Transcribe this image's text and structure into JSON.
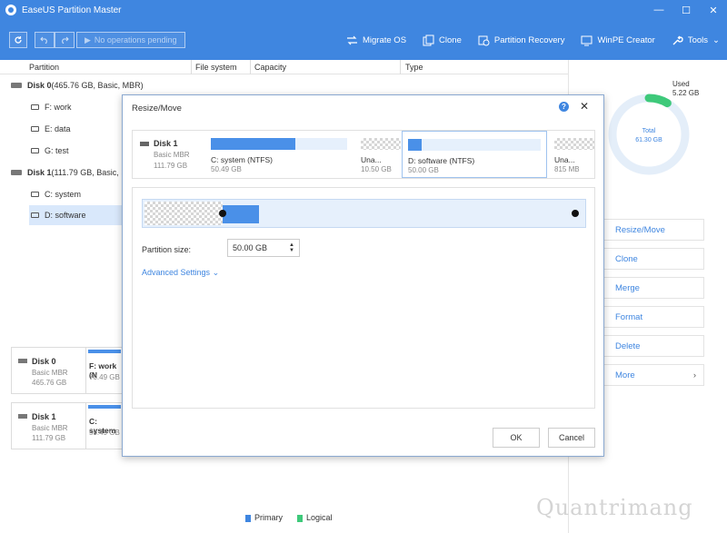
{
  "window": {
    "title": "EaseUS Partition Master"
  },
  "toolbar": {
    "pending": "No operations pending",
    "tools": [
      {
        "label": "Migrate OS",
        "icon": "migrate-icon"
      },
      {
        "label": "Clone",
        "icon": "clone-icon"
      },
      {
        "label": "Partition Recovery",
        "icon": "recovery-icon"
      },
      {
        "label": "WinPE Creator",
        "icon": "winpe-icon"
      },
      {
        "label": "Tools",
        "icon": "wrench-icon"
      }
    ]
  },
  "columns": {
    "partition": "Partition",
    "filesystem": "File system",
    "capacity": "Capacity",
    "type": "Type"
  },
  "tree": [
    {
      "label": "Disk 0",
      "extra": " (465.76 GB, Basic, MBR)",
      "kind": "disk"
    },
    {
      "label": "F: work",
      "kind": "part"
    },
    {
      "label": "E: data",
      "kind": "part"
    },
    {
      "label": "G: test",
      "kind": "part"
    },
    {
      "label": "Disk 1",
      "extra": " (111.79 GB, Basic, MBR)",
      "kind": "disk"
    },
    {
      "label": "C: system",
      "kind": "part"
    },
    {
      "label": "D: software",
      "kind": "part"
    }
  ],
  "disk_cards": [
    {
      "name": "Disk 0",
      "sub": "Basic MBR",
      "size": "465.76 GB",
      "part_name": "F: work (N",
      "part_size": "70.49 GB"
    },
    {
      "name": "Disk 1",
      "sub": "Basic MBR",
      "size": "111.79 GB",
      "part_name": "C: system",
      "part_size": "50.49 GB"
    }
  ],
  "legend": {
    "primary": "Primary",
    "logical": "Logical",
    "primary_color": "#3f86e0",
    "logical_color": "#3ec97a"
  },
  "usage": {
    "used_label": "Used",
    "used_value": "5.22 GB",
    "total_label": "Total",
    "total_value": "61.30 GB",
    "used_fraction": 0.085
  },
  "actions": [
    {
      "label": "Resize/Move"
    },
    {
      "label": "Clone"
    },
    {
      "label": "Merge"
    },
    {
      "label": "Format"
    },
    {
      "label": "Delete"
    },
    {
      "label": "More"
    }
  ],
  "dialog": {
    "title": "Resize/Move",
    "disk": {
      "name": "Disk 1",
      "sub": "Basic MBR",
      "size": "111.79 GB"
    },
    "partitions": [
      {
        "name": "C: system (NTFS)",
        "size": "50.49 GB",
        "used_fraction": 0.62
      },
      {
        "name": "Una...",
        "size": "10.50 GB"
      },
      {
        "name": "D: software (NTFS)",
        "size": "50.00 GB",
        "used_fraction": 0.1
      },
      {
        "name": "Una...",
        "size": "815 MB"
      }
    ],
    "partition_size_label": "Partition size:",
    "partition_size_value": "50.00 GB",
    "advanced": "Advanced Settings",
    "ok": "OK",
    "cancel": "Cancel"
  },
  "watermark": "Quantrimang"
}
